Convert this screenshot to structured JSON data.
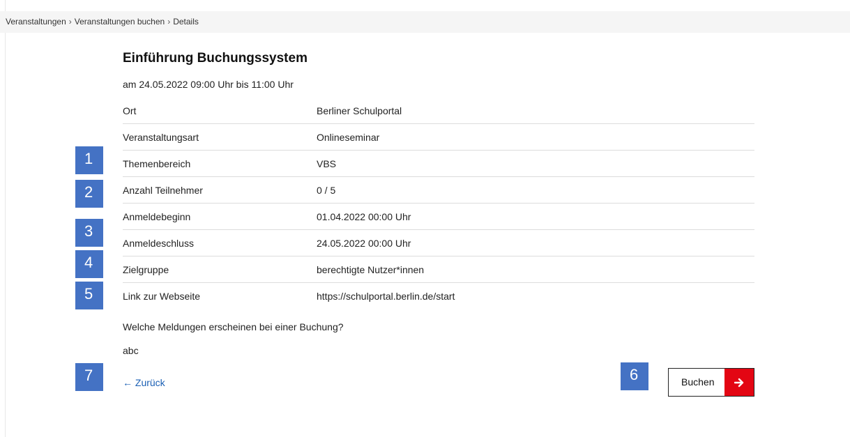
{
  "breadcrumb": {
    "items": [
      "Veranstaltungen",
      "Veranstaltungen buchen",
      "Details"
    ],
    "separator": "›"
  },
  "event": {
    "title": "Einführung Buchungssystem",
    "date": "am 24.05.2022 09:00 Uhr bis 11:00 Uhr",
    "details": [
      {
        "label": "Ort",
        "value": "Berliner Schulportal"
      },
      {
        "label": "Veranstaltungsart",
        "value": "Onlineseminar"
      },
      {
        "label": "Themenbereich",
        "value": "VBS"
      },
      {
        "label": "Anzahl Teilnehmer",
        "value": "0 / 5"
      },
      {
        "label": "Anmeldebeginn",
        "value": "01.04.2022 00:00 Uhr"
      },
      {
        "label": "Anmeldeschluss",
        "value": "24.05.2022 00:00 Uhr"
      },
      {
        "label": "Zielgruppe",
        "value": "berechtigte Nutzer*innen"
      },
      {
        "label": "Link zur Webseite",
        "value": "https://schulportal.berlin.de/start"
      }
    ],
    "question": "Welche Meldungen erscheinen bei einer Buchung?",
    "answer": "abc"
  },
  "actions": {
    "back_label": "Zurück",
    "back_icon": "arrow-left-icon",
    "book_label": "Buchen",
    "book_icon": "arrow-right-icon"
  },
  "markers": [
    "1",
    "2",
    "3",
    "4",
    "5",
    "6",
    "7"
  ],
  "colors": {
    "marker_bg": "#4472c4",
    "book_accent": "#e30613",
    "link": "#1a5fb4"
  }
}
